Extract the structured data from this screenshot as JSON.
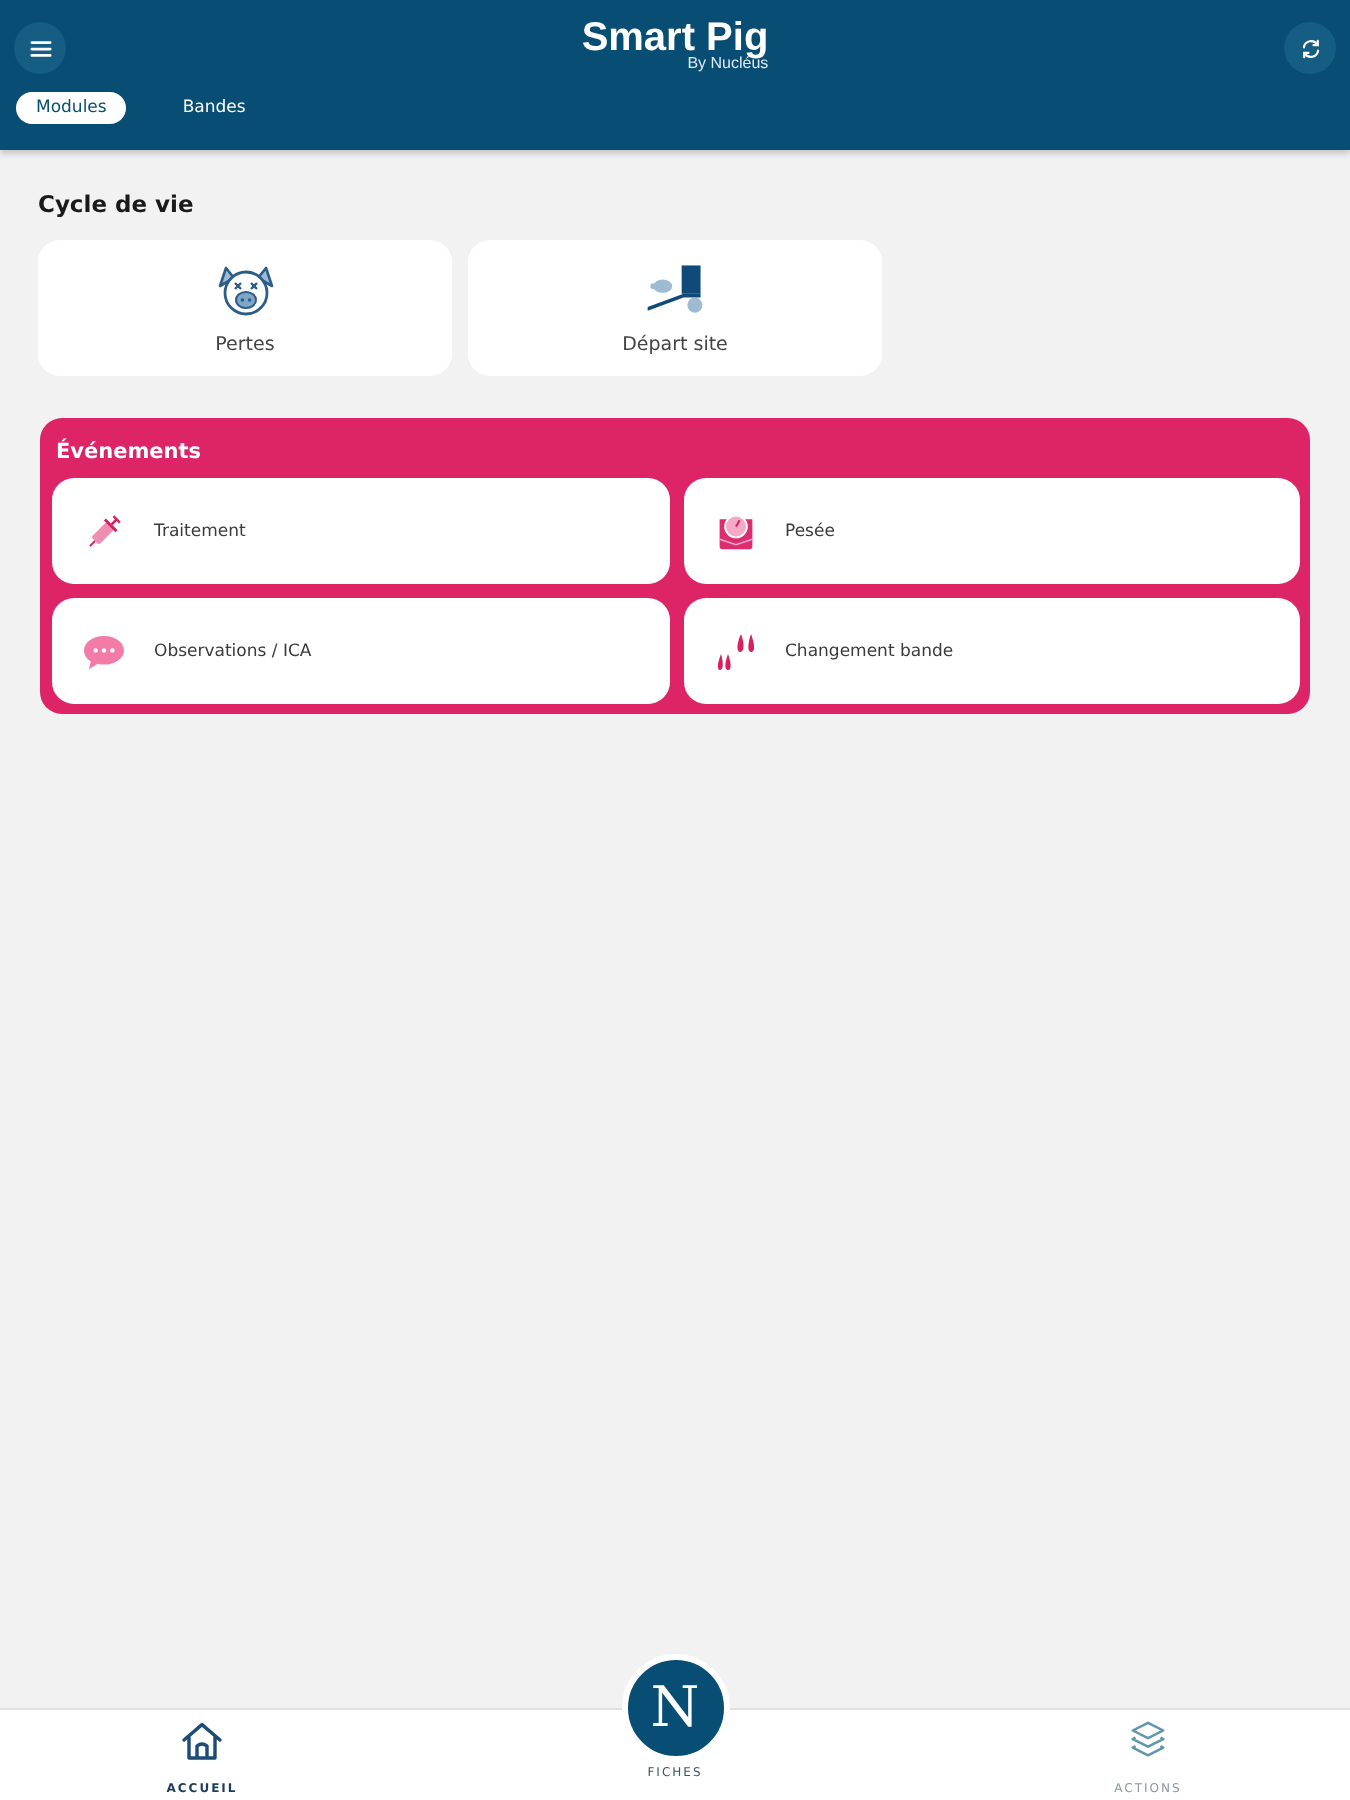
{
  "header": {
    "title": "Smart Pig",
    "subtitle": "By Nucléus"
  },
  "tabs": [
    {
      "label": "Modules",
      "selected": true
    },
    {
      "label": "Bandes",
      "selected": false
    }
  ],
  "lifecycle": {
    "title": "Cycle de vie",
    "cards": [
      {
        "label": "Pertes",
        "kind": "pig"
      },
      {
        "label": "Départ site",
        "kind": "departure"
      }
    ]
  },
  "events": {
    "title": "Événements",
    "items": [
      {
        "label": "Traitement",
        "kind": "syringe"
      },
      {
        "label": "Pesée",
        "kind": "scale"
      },
      {
        "label": "Observations / ICA",
        "kind": "chat"
      },
      {
        "label": "Changement bande",
        "kind": "hooves"
      }
    ]
  },
  "bottom_nav": [
    {
      "label": "ACCUEIL",
      "kind": "home",
      "selected": true
    },
    {
      "label": "FICHES",
      "kind": "logo",
      "logo_text": "N",
      "selected": false
    },
    {
      "label": "ACTIONS",
      "kind": "layers",
      "selected": false
    }
  ]
}
